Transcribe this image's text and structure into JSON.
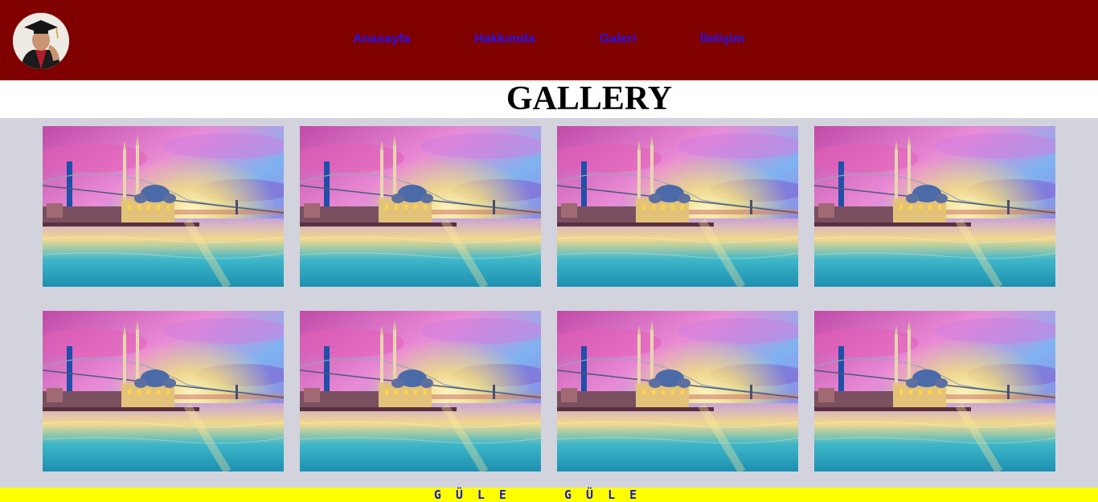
{
  "header": {
    "avatar_icon": "graduate-portrait",
    "background": "#800000",
    "nav": [
      {
        "label": "Anasayfa"
      },
      {
        "label": "Hakkımda"
      },
      {
        "label": "Galeri"
      },
      {
        "label": "İletişim"
      }
    ],
    "nav_color": "#2b12e6"
  },
  "page": {
    "title": "GALLERY"
  },
  "gallery": {
    "image_subject": "istanbul-ortakoy-mosque-sunset",
    "image_count": 8
  },
  "footer": {
    "text": "GÜLE  GÜLE",
    "background": "#ffff00",
    "color": "#1a1ad0"
  }
}
